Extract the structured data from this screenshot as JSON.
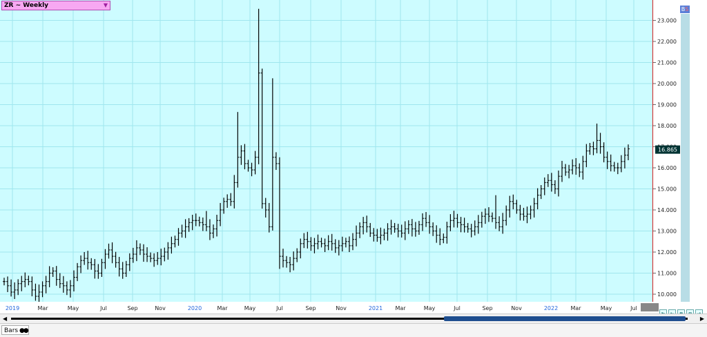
{
  "symbol_selector": {
    "label": "ZR ~ Weekly"
  },
  "buttons": {
    "bs_b": "B",
    "bs_s": "S"
  },
  "status": {
    "bars_tab": "Bars"
  },
  "current_price": "16.865",
  "colors": {
    "chart_bg": "#cdfcff",
    "grid": "#9fe6ee",
    "bars": "#000000",
    "axis_line": "#d02020",
    "year_label": "#2266dd",
    "price_marker": "#003333"
  },
  "chart_data": {
    "type": "ohlc-bar",
    "title": "ZR ~ Weekly",
    "xlabel": "",
    "ylabel": "",
    "ylim": [
      9.5,
      24.3
    ],
    "y_ticks": [
      "10.000",
      "11.000",
      "12.000",
      "13.000",
      "14.000",
      "15.000",
      "16.000",
      "17.000",
      "18.000",
      "19.000",
      "20.000",
      "21.000",
      "22.000",
      "23.000"
    ],
    "x_ticks": [
      {
        "label": "2019",
        "year": true
      },
      {
        "label": "Mar"
      },
      {
        "label": "May"
      },
      {
        "label": "Jul"
      },
      {
        "label": "Sep"
      },
      {
        "label": "Nov"
      },
      {
        "label": "2020",
        "year": true
      },
      {
        "label": "Mar"
      },
      {
        "label": "May"
      },
      {
        "label": "Jul"
      },
      {
        "label": "Sep"
      },
      {
        "label": "Nov"
      },
      {
        "label": "2021",
        "year": true
      },
      {
        "label": "Mar"
      },
      {
        "label": "May"
      },
      {
        "label": "Jul"
      },
      {
        "label": "Sep"
      },
      {
        "label": "Nov"
      },
      {
        "label": "2022",
        "year": true
      },
      {
        "label": "Mar"
      },
      {
        "label": "May"
      },
      {
        "label": "Jul"
      }
    ],
    "close": [
      10.6,
      10.4,
      10.1,
      10.2,
      10.5,
      10.6,
      10.7,
      10.6,
      10.2,
      9.9,
      10.1,
      10.4,
      10.6,
      11.0,
      11.1,
      10.7,
      10.5,
      10.4,
      10.2,
      10.4,
      10.8,
      11.3,
      11.6,
      11.7,
      11.5,
      11.4,
      11.1,
      11.0,
      11.5,
      11.9,
      12.1,
      11.8,
      11.5,
      11.2,
      11.0,
      11.4,
      11.7,
      11.9,
      12.2,
      12.1,
      11.9,
      11.8,
      11.7,
      11.6,
      11.7,
      11.8,
      12.0,
      12.2,
      12.4,
      12.6,
      12.9,
      13.0,
      13.2,
      13.4,
      13.5,
      13.5,
      13.4,
      13.3,
      13.2,
      12.9,
      13.1,
      13.5,
      14.0,
      14.4,
      14.5,
      14.4,
      15.3,
      16.5,
      16.8,
      16.2,
      16.0,
      15.9,
      16.5,
      20.5,
      14.3,
      14.0,
      13.2,
      16.5,
      16.2,
      11.8,
      11.6,
      11.5,
      11.4,
      11.7,
      12.0,
      12.4,
      12.6,
      12.5,
      12.3,
      12.4,
      12.5,
      12.4,
      12.3,
      12.5,
      12.4,
      12.2,
      12.3,
      12.4,
      12.5,
      12.3,
      12.6,
      12.9,
      13.2,
      13.4,
      13.2,
      12.9,
      12.8,
      12.7,
      12.8,
      12.9,
      13.1,
      13.2,
      13.1,
      13.0,
      12.9,
      13.1,
      13.3,
      13.1,
      13.0,
      13.3,
      13.6,
      13.4,
      13.2,
      13.0,
      12.8,
      12.6,
      12.7,
      13.2,
      13.5,
      13.6,
      13.4,
      13.3,
      13.2,
      13.1,
      13.0,
      13.2,
      13.4,
      13.7,
      13.8,
      13.7,
      13.6,
      13.4,
      13.2,
      13.5,
      14.0,
      14.4,
      14.3,
      14.0,
      13.8,
      13.7,
      13.8,
      14.0,
      14.3,
      14.7,
      15.0,
      15.3,
      15.4,
      15.2,
      15.0,
      15.6,
      16.0,
      15.8,
      15.9,
      16.1,
      16.0,
      15.8,
      16.3,
      16.8,
      17.0,
      16.9,
      17.3,
      17.0,
      16.5,
      16.3,
      16.1,
      16.0,
      16.0,
      16.3,
      16.6,
      16.9
    ],
    "highs": {
      "73": 23.55,
      "77": 20.25,
      "67": 18.65,
      "170": 18.1,
      "58": 13.95,
      "141": 14.7
    },
    "lows": {
      "79": 11.2
    }
  }
}
